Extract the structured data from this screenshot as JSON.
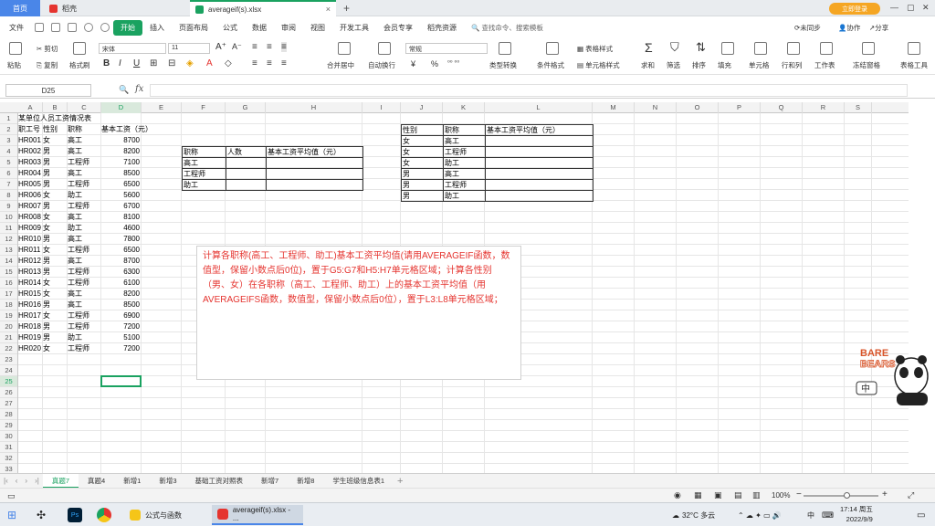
{
  "window_tabs": {
    "home": "首页",
    "daoke": "稻壳",
    "file": "averageif(s).xlsx",
    "login": "立即登录"
  },
  "menu": {
    "file": "文件",
    "items": [
      "开始",
      "插入",
      "页面布局",
      "公式",
      "数据",
      "审阅",
      "视图",
      "开发工具",
      "会员专享",
      "稻壳资源"
    ],
    "active_index": 0,
    "search": "查找命令、搜索模板",
    "right": [
      "未同步",
      "协作",
      "分享"
    ]
  },
  "ribbon": {
    "paste": "粘贴",
    "cut": "剪切",
    "copy": "复制",
    "format_painter": "格式刷",
    "font_name": "宋体",
    "font_size": "11",
    "bold": "B",
    "italic": "I",
    "underline": "U",
    "merge": "合并居中",
    "wrap": "自动换行",
    "number_format": "常规",
    "currency": "¥",
    "percent": "%",
    "type_convert": "类型转换",
    "cond_format": "条件格式",
    "table_style": "表格样式",
    "cell_style": "单元格样式",
    "sum": "求和",
    "filter": "筛选",
    "sort": "排序",
    "fill": "填充",
    "cell": "单元格",
    "rowcol": "行和列",
    "sheet": "工作表",
    "freeze": "冻结窗格",
    "table_tools": "表格工具"
  },
  "formula_bar": {
    "name_box": "D25",
    "fx": "fx"
  },
  "grid": {
    "columns": [
      "A",
      "B",
      "C",
      "D",
      "E",
      "F",
      "G",
      "H",
      "I",
      "J",
      "K",
      "L",
      "M",
      "N",
      "O",
      "P",
      "Q",
      "R",
      "S"
    ],
    "selected_col": "D",
    "rows": [
      "1",
      "2",
      "3",
      "4",
      "5",
      "6",
      "7",
      "8",
      "9",
      "10",
      "11",
      "12",
      "13",
      "14",
      "15",
      "16",
      "17",
      "18",
      "19",
      "20",
      "21",
      "22",
      "23",
      "24",
      "25",
      "26",
      "27",
      "28",
      "29",
      "30",
      "31",
      "32",
      "33"
    ],
    "selected_row": "25"
  },
  "sheet": {
    "title": "某单位人员工资情况表",
    "headers": [
      "职工号",
      "性别",
      "职称",
      "基本工资（元）"
    ],
    "records": [
      [
        "HR001",
        "女",
        "高工",
        "8700"
      ],
      [
        "HR002",
        "男",
        "高工",
        "8200"
      ],
      [
        "HR003",
        "男",
        "工程师",
        "7100"
      ],
      [
        "HR004",
        "男",
        "高工",
        "8500"
      ],
      [
        "HR005",
        "男",
        "工程师",
        "6500"
      ],
      [
        "HR006",
        "女",
        "助工",
        "5600"
      ],
      [
        "HR007",
        "男",
        "工程师",
        "6700"
      ],
      [
        "HR008",
        "女",
        "高工",
        "8100"
      ],
      [
        "HR009",
        "女",
        "助工",
        "4600"
      ],
      [
        "HR010",
        "男",
        "高工",
        "7800"
      ],
      [
        "HR011",
        "女",
        "工程师",
        "6500"
      ],
      [
        "HR012",
        "男",
        "高工",
        "8700"
      ],
      [
        "HR013",
        "男",
        "工程师",
        "6300"
      ],
      [
        "HR014",
        "女",
        "工程师",
        "6100"
      ],
      [
        "HR015",
        "女",
        "高工",
        "8200"
      ],
      [
        "HR016",
        "男",
        "高工",
        "8500"
      ],
      [
        "HR017",
        "女",
        "工程师",
        "6900"
      ],
      [
        "HR018",
        "男",
        "工程师",
        "7200"
      ],
      [
        "HR019",
        "男",
        "助工",
        "5100"
      ],
      [
        "HR020",
        "女",
        "工程师",
        "7200"
      ]
    ],
    "table1": {
      "headers": [
        "职称",
        "人数",
        "基本工资平均值（元）"
      ],
      "rows": [
        "高工",
        "工程师",
        "助工"
      ]
    },
    "table2": {
      "headers": [
        "性别",
        "职称",
        "基本工资平均值（元）"
      ],
      "rows": [
        [
          "女",
          "高工"
        ],
        [
          "女",
          "工程师"
        ],
        [
          "女",
          "助工"
        ],
        [
          "男",
          "高工"
        ],
        [
          "男",
          "工程师"
        ],
        [
          "男",
          "助工"
        ]
      ]
    },
    "note": "计算各职称(高工、工程师、助工)基本工资平均值(请用AVERAGEIF函数，数值型，保留小数点后0位)，置于G5:G7和H5:H7单元格区域；计算各性别（男、女）在各职称（高工、工程师、助工）上的基本工资平均值（用AVERAGEIFS函数，数值型，保留小数点后0位），置于L3:L8单元格区域；"
  },
  "sheet_tabs": [
    "真题7",
    "真题4",
    "新增1",
    "新增3",
    "基础工资对照表",
    "新增7",
    "新增8",
    "学生班级信息表1"
  ],
  "active_sheet": 0,
  "status": {
    "zoom": "100%"
  },
  "taskbar": {
    "apps": [
      "公式与函数",
      "averageif(s).xlsx - ..."
    ],
    "weather": "32°C 多云",
    "lang": "中",
    "time": "17:14 周五",
    "date": "2022/9/9"
  },
  "mascot": {
    "brand": "BARE BEARS"
  },
  "colors": {
    "accent": "#1aa260",
    "note_text": "#e5342f",
    "brand_blue": "#4a86e8"
  }
}
